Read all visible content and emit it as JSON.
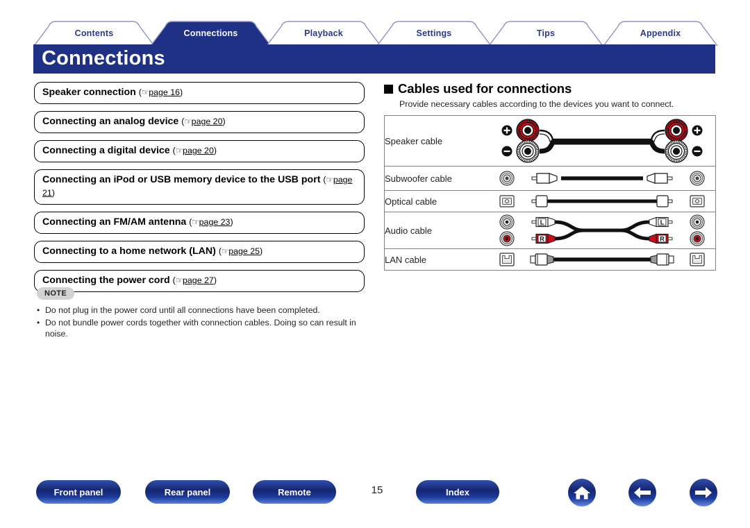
{
  "header": {
    "title": "Connections",
    "tabs": [
      {
        "label": "Contents",
        "active": false
      },
      {
        "label": "Connections",
        "active": true
      },
      {
        "label": "Playback",
        "active": false
      },
      {
        "label": "Settings",
        "active": false
      },
      {
        "label": "Tips",
        "active": false
      },
      {
        "label": "Appendix",
        "active": false
      }
    ]
  },
  "links": [
    {
      "title": "Speaker connection",
      "ref_prefix": "page",
      "page": "16",
      "lines": 1
    },
    {
      "title": "Connecting an analog device",
      "ref_prefix": "page",
      "page": "20",
      "lines": 1
    },
    {
      "title": "Connecting a digital device",
      "ref_prefix": "page",
      "page": "20",
      "lines": 1
    },
    {
      "title": "Connecting an iPod or USB memory device to the USB port",
      "ref_prefix": "page",
      "page": "21",
      "lines": 2
    },
    {
      "title": "Connecting an FM/AM antenna",
      "ref_prefix": "page",
      "page": "23",
      "lines": 1
    },
    {
      "title": "Connecting to a home network (LAN)",
      "ref_prefix": "page",
      "page": "25",
      "lines": 1
    },
    {
      "title": "Connecting the power cord",
      "ref_prefix": "page",
      "page": "27",
      "lines": 1
    }
  ],
  "note": {
    "label": "NOTE",
    "items": [
      "Do not plug in the power cord until all connections have been completed.",
      "Do not bundle power cords together with connection cables. Doing so can result in noise."
    ]
  },
  "cables": {
    "heading": "Cables used for connections",
    "subtitle": "Provide necessary cables according to the devices you want to connect.",
    "rows": [
      {
        "name": "Speaker cable",
        "figure": "speaker-cable-diagram",
        "markers": [
          "+",
          "−"
        ]
      },
      {
        "name": "Subwoofer cable",
        "figure": "subwoofer-cable-diagram",
        "markers": []
      },
      {
        "name": "Optical cable",
        "figure": "optical-cable-diagram",
        "markers": []
      },
      {
        "name": "Audio cable",
        "figure": "audio-cable-diagram",
        "markers": [
          "L",
          "R"
        ]
      },
      {
        "name": "LAN cable",
        "figure": "lan-cable-diagram",
        "markers": []
      }
    ]
  },
  "footer": {
    "buttons": [
      {
        "label": "Front panel"
      },
      {
        "label": "Rear panel"
      },
      {
        "label": "Remote"
      },
      {
        "label": "Index"
      }
    ],
    "page_number": "15",
    "icons": [
      {
        "name": "home-icon"
      },
      {
        "name": "back-arrow-icon"
      },
      {
        "name": "forward-arrow-icon"
      }
    ]
  },
  "colors": {
    "brand_blue": "#1f3184",
    "tab_text_blue": "#2b3990",
    "tab_outline": "#8e93c6",
    "accent_red": "#cc0c17",
    "note_gray": "#d2d2d2",
    "table_border": "#808080"
  }
}
